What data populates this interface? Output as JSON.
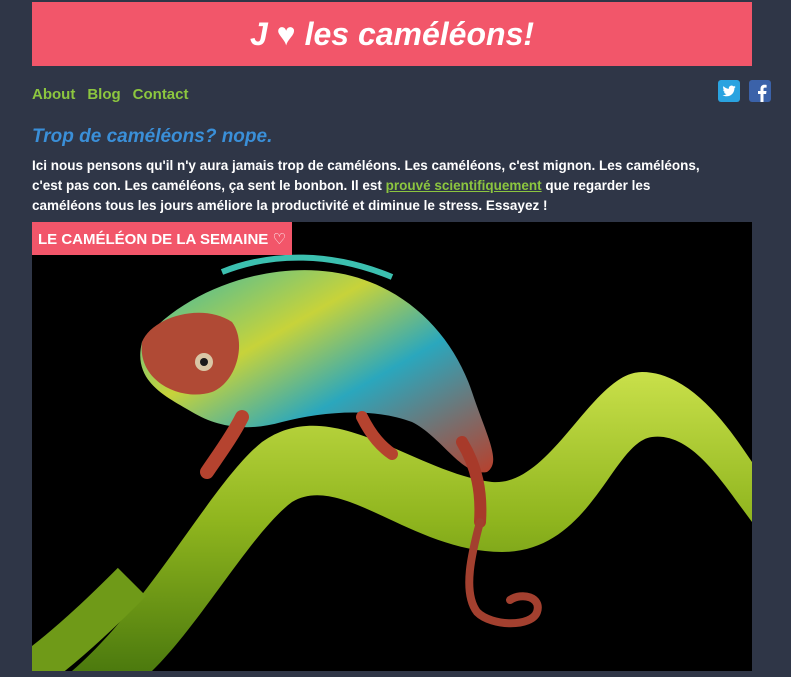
{
  "header": {
    "title": "J ♥ les caméléons!"
  },
  "nav": {
    "items": [
      {
        "label": "About"
      },
      {
        "label": "Blog"
      },
      {
        "label": "Contact"
      }
    ]
  },
  "social": {
    "twitter_icon": "twitter-icon",
    "facebook_icon": "facebook-icon"
  },
  "main": {
    "tagline": "Trop de caméléons? nope.",
    "intro_part1": "Ici nous pensons qu'il n'y aura jamais trop de caméléons. Les caméléons, c'est mignon. Les caméléons, c'est pas con. Les caméléons, ça sent le bonbon. Il est ",
    "intro_link": "prouvé scientifiquement",
    "intro_part2": " que regarder les caméléons tous les jours améliore la productivité et diminue le stress. Essayez !"
  },
  "feature": {
    "label": "LE CAMÉLÉON DE LA SEMAINE ♡"
  },
  "colors": {
    "background": "#2f3647",
    "banner": "#f2566a",
    "nav_link": "#8cc63f",
    "tagline": "#3a8fd8"
  }
}
